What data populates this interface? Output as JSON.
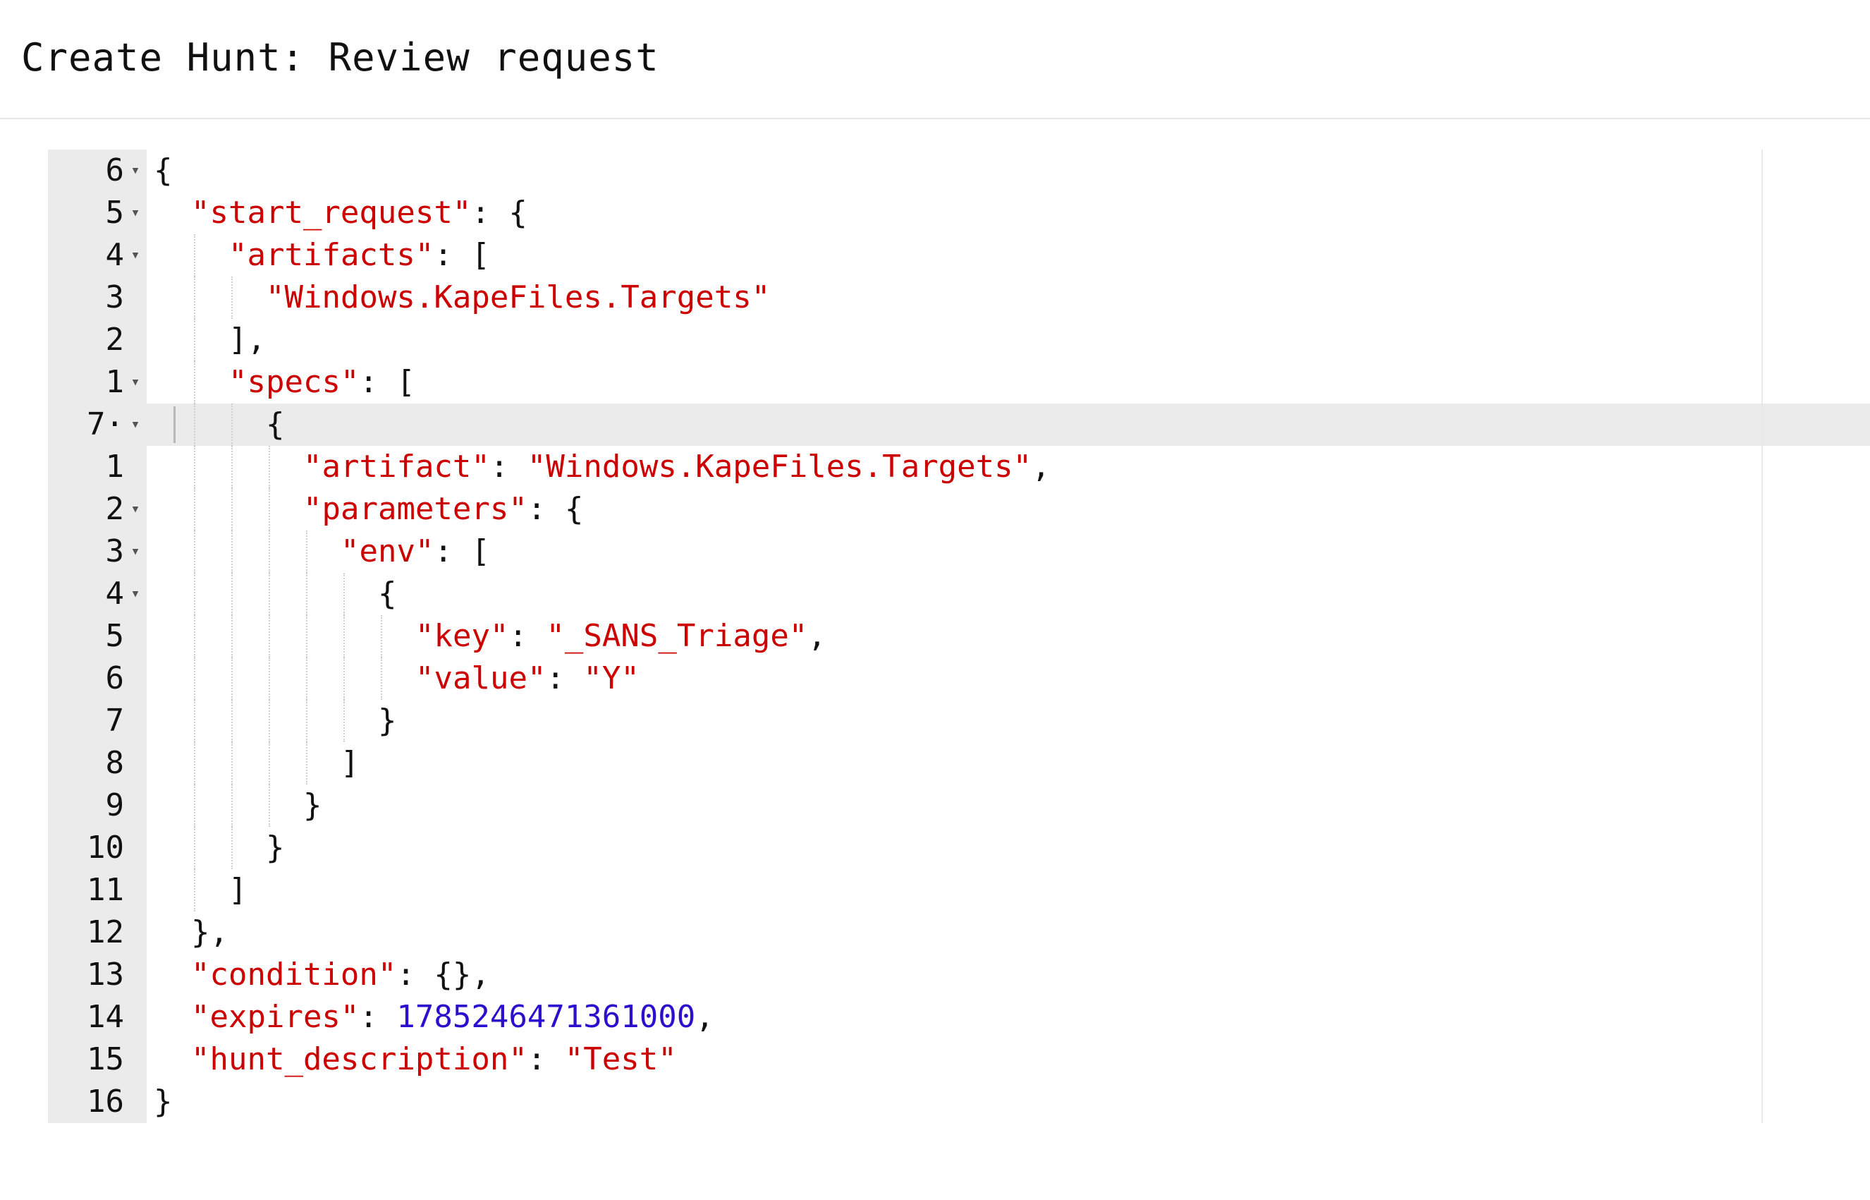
{
  "page": {
    "title": "Create Hunt: Review request"
  },
  "editor": {
    "active_line_index": 6,
    "lines": [
      {
        "number": "6",
        "fold": true,
        "indent": 0,
        "tokens": [
          {
            "t": "p",
            "v": "{"
          }
        ]
      },
      {
        "number": "5",
        "fold": true,
        "indent": 1,
        "tokens": [
          {
            "t": "k",
            "v": "\"start_request\""
          },
          {
            "t": "p",
            "v": ": {"
          }
        ]
      },
      {
        "number": "4",
        "fold": true,
        "indent": 2,
        "tokens": [
          {
            "t": "k",
            "v": "\"artifacts\""
          },
          {
            "t": "p",
            "v": ": ["
          }
        ]
      },
      {
        "number": "3",
        "fold": false,
        "indent": 3,
        "tokens": [
          {
            "t": "s",
            "v": "\"Windows.KapeFiles.Targets\""
          }
        ]
      },
      {
        "number": "2",
        "fold": false,
        "indent": 2,
        "tokens": [
          {
            "t": "p",
            "v": "],"
          }
        ]
      },
      {
        "number": "1",
        "fold": true,
        "indent": 2,
        "tokens": [
          {
            "t": "k",
            "v": "\"specs\""
          },
          {
            "t": "p",
            "v": ": ["
          }
        ]
      },
      {
        "number": "7·",
        "fold": true,
        "indent": 3,
        "tokens": [
          {
            "t": "p",
            "v": "{"
          }
        ]
      },
      {
        "number": "1",
        "fold": false,
        "indent": 4,
        "tokens": [
          {
            "t": "k",
            "v": "\"artifact\""
          },
          {
            "t": "p",
            "v": ": "
          },
          {
            "t": "s",
            "v": "\"Windows.KapeFiles.Targets\""
          },
          {
            "t": "p",
            "v": ","
          }
        ]
      },
      {
        "number": "2",
        "fold": true,
        "indent": 4,
        "tokens": [
          {
            "t": "k",
            "v": "\"parameters\""
          },
          {
            "t": "p",
            "v": ": {"
          }
        ]
      },
      {
        "number": "3",
        "fold": true,
        "indent": 5,
        "tokens": [
          {
            "t": "k",
            "v": "\"env\""
          },
          {
            "t": "p",
            "v": ": ["
          }
        ]
      },
      {
        "number": "4",
        "fold": true,
        "indent": 6,
        "tokens": [
          {
            "t": "p",
            "v": "{"
          }
        ]
      },
      {
        "number": "5",
        "fold": false,
        "indent": 7,
        "tokens": [
          {
            "t": "k",
            "v": "\"key\""
          },
          {
            "t": "p",
            "v": ": "
          },
          {
            "t": "s",
            "v": "\"_SANS_Triage\""
          },
          {
            "t": "p",
            "v": ","
          }
        ]
      },
      {
        "number": "6",
        "fold": false,
        "indent": 7,
        "tokens": [
          {
            "t": "k",
            "v": "\"value\""
          },
          {
            "t": "p",
            "v": ": "
          },
          {
            "t": "s",
            "v": "\"Y\""
          }
        ]
      },
      {
        "number": "7",
        "fold": false,
        "indent": 6,
        "tokens": [
          {
            "t": "p",
            "v": "}"
          }
        ]
      },
      {
        "number": "8",
        "fold": false,
        "indent": 5,
        "tokens": [
          {
            "t": "p",
            "v": "]"
          }
        ]
      },
      {
        "number": "9",
        "fold": false,
        "indent": 4,
        "tokens": [
          {
            "t": "p",
            "v": "}"
          }
        ]
      },
      {
        "number": "10",
        "fold": false,
        "indent": 3,
        "tokens": [
          {
            "t": "p",
            "v": "}"
          }
        ]
      },
      {
        "number": "11",
        "fold": false,
        "indent": 2,
        "tokens": [
          {
            "t": "p",
            "v": "]"
          }
        ]
      },
      {
        "number": "12",
        "fold": false,
        "indent": 1,
        "tokens": [
          {
            "t": "p",
            "v": "},"
          }
        ]
      },
      {
        "number": "13",
        "fold": false,
        "indent": 1,
        "tokens": [
          {
            "t": "k",
            "v": "\"condition\""
          },
          {
            "t": "p",
            "v": ": {},"
          }
        ]
      },
      {
        "number": "14",
        "fold": false,
        "indent": 1,
        "tokens": [
          {
            "t": "k",
            "v": "\"expires\""
          },
          {
            "t": "p",
            "v": ": "
          },
          {
            "t": "n",
            "v": "1785246471361000"
          },
          {
            "t": "p",
            "v": ","
          }
        ]
      },
      {
        "number": "15",
        "fold": false,
        "indent": 1,
        "tokens": [
          {
            "t": "k",
            "v": "\"hunt_description\""
          },
          {
            "t": "p",
            "v": ": "
          },
          {
            "t": "s",
            "v": "\"Test\""
          }
        ]
      },
      {
        "number": "16",
        "fold": false,
        "indent": 0,
        "tokens": [
          {
            "t": "p",
            "v": "}"
          }
        ]
      }
    ]
  },
  "colors": {
    "key": "#cc0000",
    "string": "#cc0000",
    "number": "#2a10cc",
    "punctuation": "#111111",
    "gutter": "#ebebeb",
    "active_line": "#ebebeb"
  }
}
